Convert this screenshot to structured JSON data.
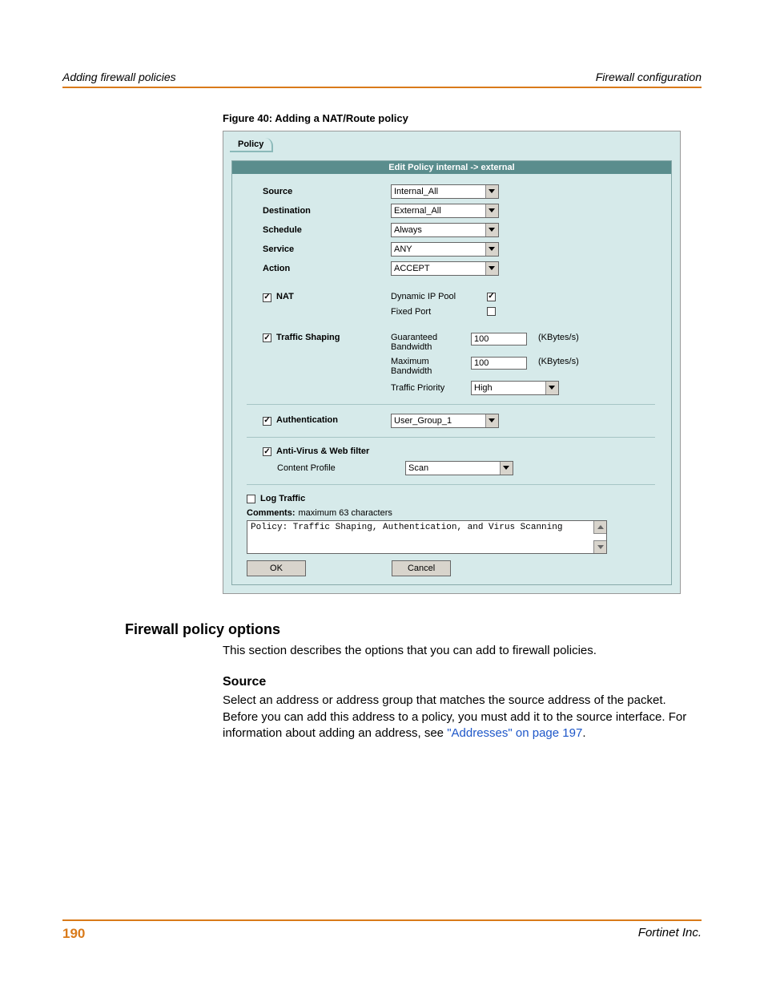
{
  "header": {
    "left": "Adding firewall policies",
    "right": "Firewall configuration"
  },
  "figure": {
    "caption": "Figure 40: Adding a NAT/Route policy"
  },
  "policy": {
    "tab": "Policy",
    "title": "Edit Policy internal -> external",
    "source_label": "Source",
    "source_value": "Internal_All",
    "destination_label": "Destination",
    "destination_value": "External_All",
    "schedule_label": "Schedule",
    "schedule_value": "Always",
    "service_label": "Service",
    "service_value": "ANY",
    "action_label": "Action",
    "action_value": "ACCEPT",
    "nat_label": "NAT",
    "dynip_label": "Dynamic IP Pool",
    "fixedport_label": "Fixed Port",
    "shaping_label": "Traffic Shaping",
    "gbw_label": "Guaranteed Bandwidth",
    "gbw_value": "100",
    "gbw_unit": "(KBytes/s)",
    "mbw_label": "Maximum Bandwidth",
    "mbw_value": "100",
    "mbw_unit": "(KBytes/s)",
    "prio_label": "Traffic Priority",
    "prio_value": "High",
    "auth_label": "Authentication",
    "auth_value": "User_Group_1",
    "av_label": "Anti-Virus & Web filter",
    "cp_label": "Content Profile",
    "cp_value": "Scan",
    "log_label": "Log Traffic",
    "comments_label": "Comments:",
    "comments_hint": "maximum 63 characters",
    "comments_value": "Policy: Traffic Shaping, Authentication, and Virus Scanning",
    "ok": "OK",
    "cancel": "Cancel"
  },
  "body": {
    "h2": "Firewall policy options",
    "p1": "This section describes the options that you can add to firewall policies.",
    "h3": "Source",
    "p2a": "Select an address or address group that matches the source address of the packet. Before you can add this address to a policy, you must add it to the source interface. For information about adding an address, see ",
    "p2link": "\"Addresses\" on page 197",
    "p2b": "."
  },
  "footer": {
    "page": "190",
    "company": "Fortinet Inc."
  }
}
